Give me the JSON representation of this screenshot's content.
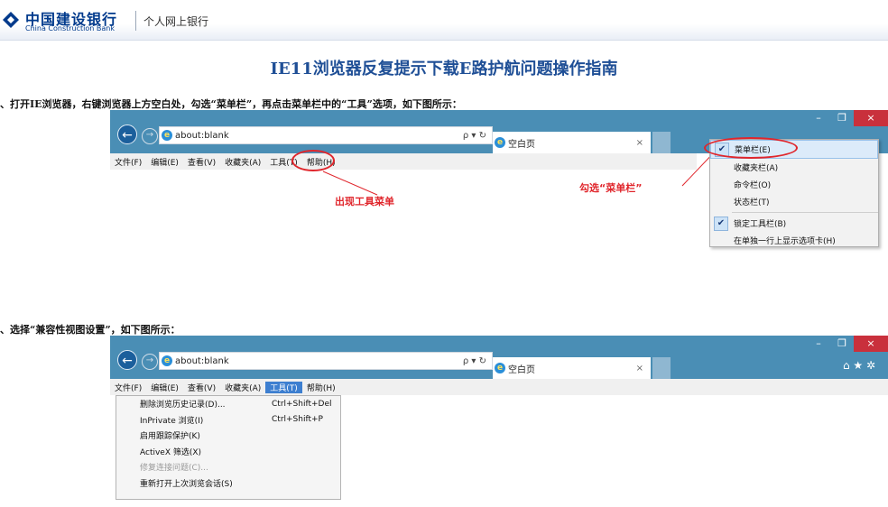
{
  "header": {
    "brand_cn": "中国建设银行",
    "brand_en": "China Construction Bank",
    "sub": "个人网上银行"
  },
  "page_title": "IE11浏览器反复提示下载E路护航问题操作指南",
  "steps": [
    "、打开IE浏览器，右键浏览器上方空白处，勾选“菜单栏”，再点击菜单栏中的“工具”选项，如下图所示：",
    "、选择“兼容性视图设置”，如下图所示："
  ],
  "browser": {
    "address": "about:blank",
    "search_icons": "ρ ▾ ↻",
    "tab_label": "空白页",
    "tab_close": "×",
    "win_min": "–",
    "win_restore": "❐",
    "win_close": "×",
    "toolbar_icons": "⌂ ★ ✲",
    "menu": [
      "文件(F)",
      "编辑(E)",
      "查看(V)",
      "收藏夹(A)",
      "工具(T)",
      "帮助(H)"
    ]
  },
  "context_menu": [
    {
      "label": "菜单栏(E)",
      "checked": true
    },
    {
      "label": "收藏夹栏(A)",
      "checked": false
    },
    {
      "label": "命令栏(O)",
      "checked": false
    },
    {
      "label": "状态栏(T)",
      "checked": false
    },
    {
      "label": "锁定工具栏(B)",
      "checked": true
    },
    {
      "label": "在单独一行上显示选项卡(H)",
      "checked": false
    }
  ],
  "tools_menu": [
    {
      "label": "删除浏览历史记录(D)...",
      "shortcut": "Ctrl+Shift+Del",
      "disabled": false
    },
    {
      "label": "InPrivate 浏览(I)",
      "shortcut": "Ctrl+Shift+P",
      "disabled": false
    },
    {
      "label": "启用跟踪保护(K)",
      "shortcut": "",
      "disabled": false
    },
    {
      "label": "ActiveX 筛选(X)",
      "shortcut": "",
      "disabled": false
    },
    {
      "label": "修复连接问题(C)...",
      "shortcut": "",
      "disabled": true
    },
    {
      "label": "重新打开上次浏览会话(S)",
      "shortcut": "",
      "disabled": false
    }
  ],
  "annotations": {
    "tools_menu": "出现工具菜单",
    "check_menubar": "勾选“菜单栏”"
  },
  "colors": {
    "brand": "#003a8c",
    "title": "#1f4f96",
    "annotation": "#e0262c",
    "browser_chrome": "#4a8eb5"
  }
}
